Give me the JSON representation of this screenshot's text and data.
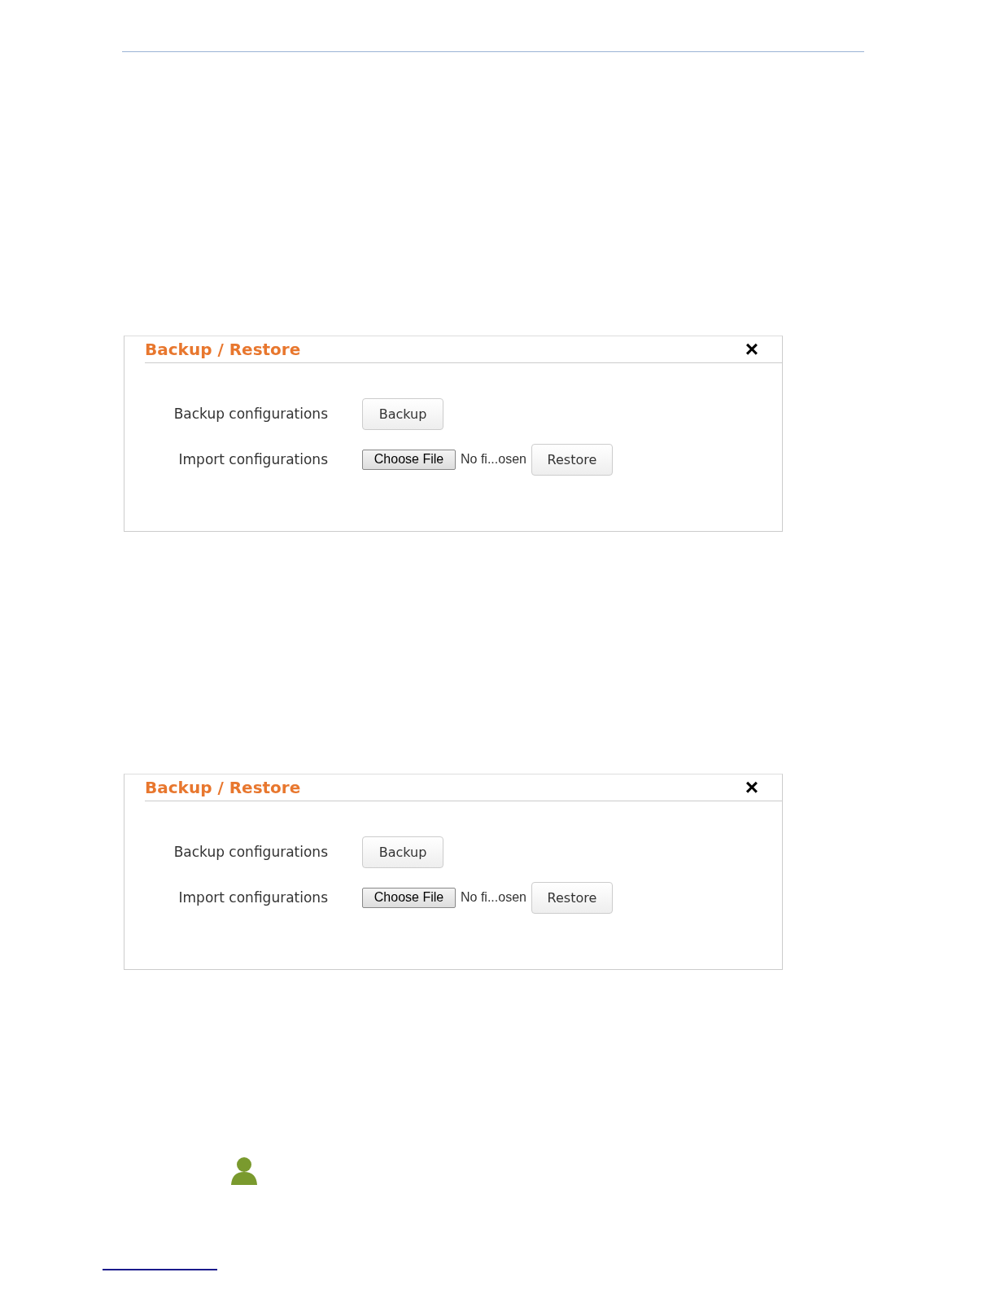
{
  "dialogs": [
    {
      "title": "Backup / Restore",
      "close": "×",
      "rows": [
        {
          "kind": "button",
          "label": "Backup configurations",
          "button": "Backup"
        },
        {
          "kind": "file",
          "label": "Import configurations",
          "choose": "Choose File",
          "file_name": "No fi...osen",
          "button": "Restore"
        }
      ]
    },
    {
      "title": "Backup / Restore",
      "close": "×",
      "rows": [
        {
          "kind": "button",
          "label": "Backup configurations",
          "button": "Backup"
        },
        {
          "kind": "file",
          "label": "Import configurations",
          "choose": "Choose File",
          "file_name": "No fi...osen",
          "button": "Restore"
        }
      ]
    }
  ]
}
